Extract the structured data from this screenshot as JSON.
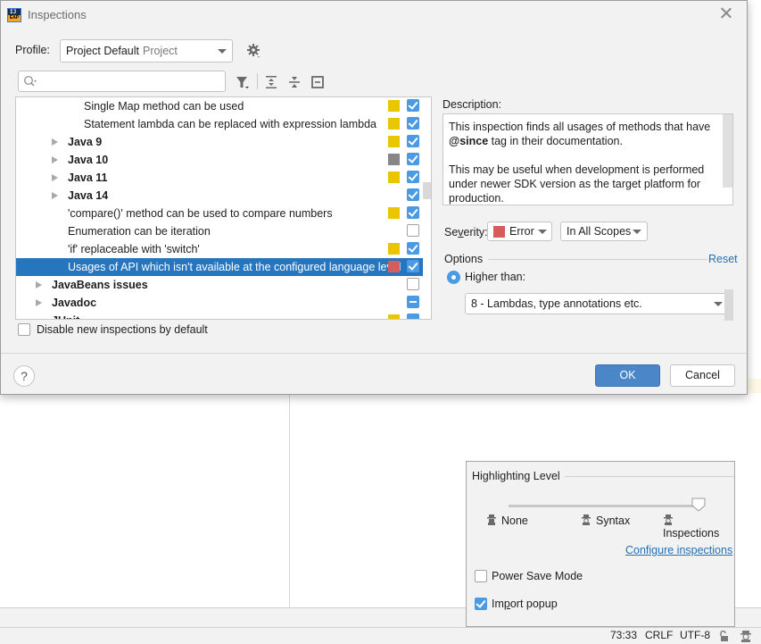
{
  "dialog": {
    "title": "Inspections",
    "profile_label": "Profile:",
    "profile_value": "Project Default",
    "profile_scope": "Project",
    "search_placeholder": "",
    "tree": [
      {
        "label": "Single Map method can be used",
        "indent": 3,
        "bold": false,
        "arrow": "none",
        "severity_color": "#e8c600",
        "check": "on",
        "selected": false
      },
      {
        "label": "Statement lambda can be replaced with expression lambda",
        "indent": 3,
        "bold": false,
        "arrow": "none",
        "severity_color": "#e8c600",
        "check": "on",
        "selected": false
      },
      {
        "label": "Java 9",
        "indent": 2,
        "bold": true,
        "arrow": "right",
        "severity_color": "#e8c600",
        "check": "on",
        "selected": false
      },
      {
        "label": "Java 10",
        "indent": 2,
        "bold": true,
        "arrow": "right",
        "severity_color": "#878787",
        "check": "on",
        "selected": false
      },
      {
        "label": "Java 11",
        "indent": 2,
        "bold": true,
        "arrow": "right",
        "severity_color": "#e8c600",
        "check": "on",
        "selected": false
      },
      {
        "label": "Java 14",
        "indent": 2,
        "bold": true,
        "arrow": "right",
        "severity_color": null,
        "check": "on",
        "selected": false
      },
      {
        "label": "'compare()' method can be used to compare numbers",
        "indent": 2,
        "bold": false,
        "arrow": "none",
        "severity_color": "#e8c600",
        "check": "on",
        "selected": false
      },
      {
        "label": "Enumeration can be iteration",
        "indent": 2,
        "bold": false,
        "arrow": "none",
        "severity_color": null,
        "check": "off",
        "selected": false
      },
      {
        "label": "'if' replaceable with 'switch'",
        "indent": 2,
        "bold": false,
        "arrow": "none",
        "severity_color": "#e8c600",
        "check": "on",
        "selected": false
      },
      {
        "label": "Usages of API which isn't available at the configured language level",
        "indent": 2,
        "bold": false,
        "arrow": "none",
        "severity_color": "#d55d5d",
        "check": "on",
        "selected": true
      },
      {
        "label": "JavaBeans issues",
        "indent": 1,
        "bold": true,
        "arrow": "right",
        "severity_color": null,
        "check": "off",
        "selected": false
      },
      {
        "label": "Javadoc",
        "indent": 1,
        "bold": true,
        "arrow": "right",
        "severity_color": null,
        "check": "partial",
        "selected": false
      },
      {
        "label": "JUnit",
        "indent": 1,
        "bold": true,
        "arrow": "down",
        "severity_color": "#e8c600",
        "check": "partial",
        "selected": false
      }
    ],
    "disable_new_label": "Disable new inspections by default",
    "description_label": "Description:",
    "description_p1_pre": "This inspection finds all usages of methods that have ",
    "description_p1_bold": "@since",
    "description_p1_post": " tag in their documentation.",
    "description_p2": "This may be useful when development is performed under newer SDK version as the target platform for production.",
    "severity_label_pre": "Se",
    "severity_label_u": "v",
    "severity_label_post": "erity:",
    "severity_value": "Error",
    "severity_color": "#d55d5d",
    "scope_value": "In All Scopes",
    "options_label": "Options",
    "reset_label": "Reset",
    "radio_label": "Higher than:",
    "language_level": "8 - Lambdas, type annotations etc.",
    "help_label": "?",
    "ok_label": "OK",
    "cancel_label": "Cancel"
  },
  "popup": {
    "title": "Highlighting Level",
    "levels": [
      "None",
      "Syntax",
      "Inspections"
    ],
    "selected_level": "Inspections",
    "configure_link": "Configure inspections",
    "power_save_label": "Power Save Mode",
    "power_save_checked": false,
    "import_popup_label": "Import popup",
    "import_popup_checked": true
  },
  "statusbar": {
    "position": "73:33",
    "line_separator": "CRLF",
    "encoding": "UTF-8"
  }
}
